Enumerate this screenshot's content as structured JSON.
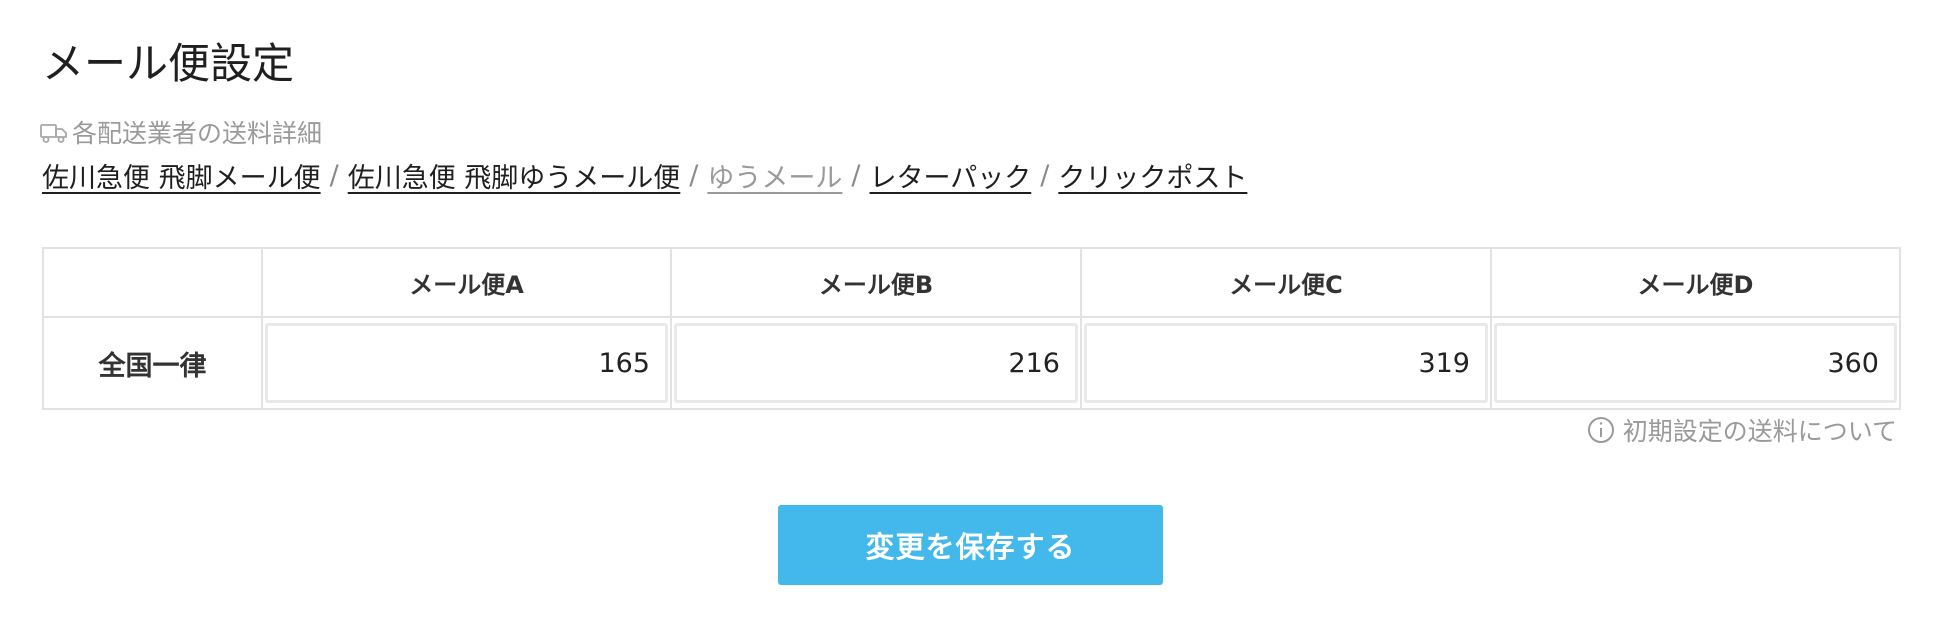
{
  "page": {
    "title": "メール便設定"
  },
  "carriers": {
    "heading": "各配送業者の送料詳細",
    "heading_icon": "truck-icon",
    "separator": "/",
    "links": [
      {
        "label": "佐川急便 飛脚メール便",
        "current": false
      },
      {
        "label": "佐川急便 飛脚ゆうメール便",
        "current": false
      },
      {
        "label": "ゆうメール",
        "current": true
      },
      {
        "label": "レターパック",
        "current": false
      },
      {
        "label": "クリックポスト",
        "current": false
      }
    ]
  },
  "rates_table": {
    "headers": [
      "",
      "メール便A",
      "メール便B",
      "メール便C",
      "メール便D"
    ],
    "rows": [
      {
        "label": "全国一律",
        "values": [
          "165",
          "216",
          "319",
          "360"
        ]
      }
    ]
  },
  "info": {
    "icon": "info-icon",
    "label": "初期設定の送料について"
  },
  "actions": {
    "save_label": "変更を保存する"
  },
  "colors": {
    "accent": "#43b8eb",
    "muted_text": "#9a9a9a",
    "border": "#e2e2e2"
  }
}
